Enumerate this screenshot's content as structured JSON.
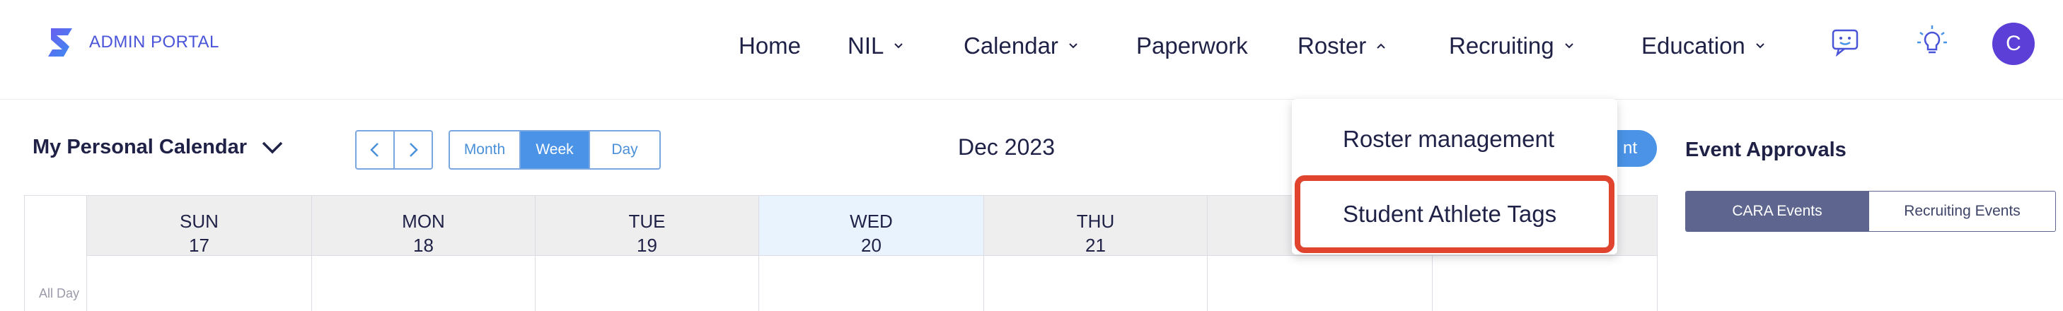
{
  "brand": {
    "name": "ADMIN PORTAL",
    "logo": "s-logo-icon"
  },
  "nav": {
    "items": [
      {
        "label": "Home",
        "has_chevron": false
      },
      {
        "label": "NIL",
        "has_chevron": true
      },
      {
        "label": "Calendar",
        "has_chevron": true
      },
      {
        "label": "Paperwork",
        "has_chevron": false
      },
      {
        "label": "Roster",
        "has_chevron": true,
        "expanded": true
      },
      {
        "label": "Recruiting",
        "has_chevron": true
      },
      {
        "label": "Education",
        "has_chevron": true
      }
    ],
    "icons": [
      "chat-support-icon",
      "lightbulb-icon"
    ],
    "avatar_initial": "C"
  },
  "calendar": {
    "title": "My Personal Calendar",
    "views": [
      "Month",
      "Week",
      "Day"
    ],
    "active_view": "Week",
    "period": "Dec 2023",
    "add_button_visible_fragment": "nt",
    "all_day_label": "All Day",
    "days": [
      {
        "name": "SUN",
        "date": "17",
        "today": false
      },
      {
        "name": "MON",
        "date": "18",
        "today": false
      },
      {
        "name": "TUE",
        "date": "19",
        "today": false
      },
      {
        "name": "WED",
        "date": "20",
        "today": true
      },
      {
        "name": "THU",
        "date": "21",
        "today": false
      },
      {
        "name": "",
        "date": "",
        "today": false
      },
      {
        "name": "",
        "date": "",
        "today": false
      }
    ]
  },
  "roster_menu": {
    "items": [
      "Roster management",
      "Student Athlete Tags"
    ],
    "highlighted": "Student Athlete Tags"
  },
  "approvals": {
    "title": "Event Approvals",
    "tabs": [
      "CARA Events",
      "Recruiting Events"
    ],
    "active_tab": "CARA Events"
  },
  "colors": {
    "brand": "#4a54d8",
    "primary": "#4a93e6",
    "today_column": "#e9f3fd",
    "highlight": "#e0442e",
    "active_segment": "#5e6690",
    "avatar": "#5b3fd6"
  }
}
